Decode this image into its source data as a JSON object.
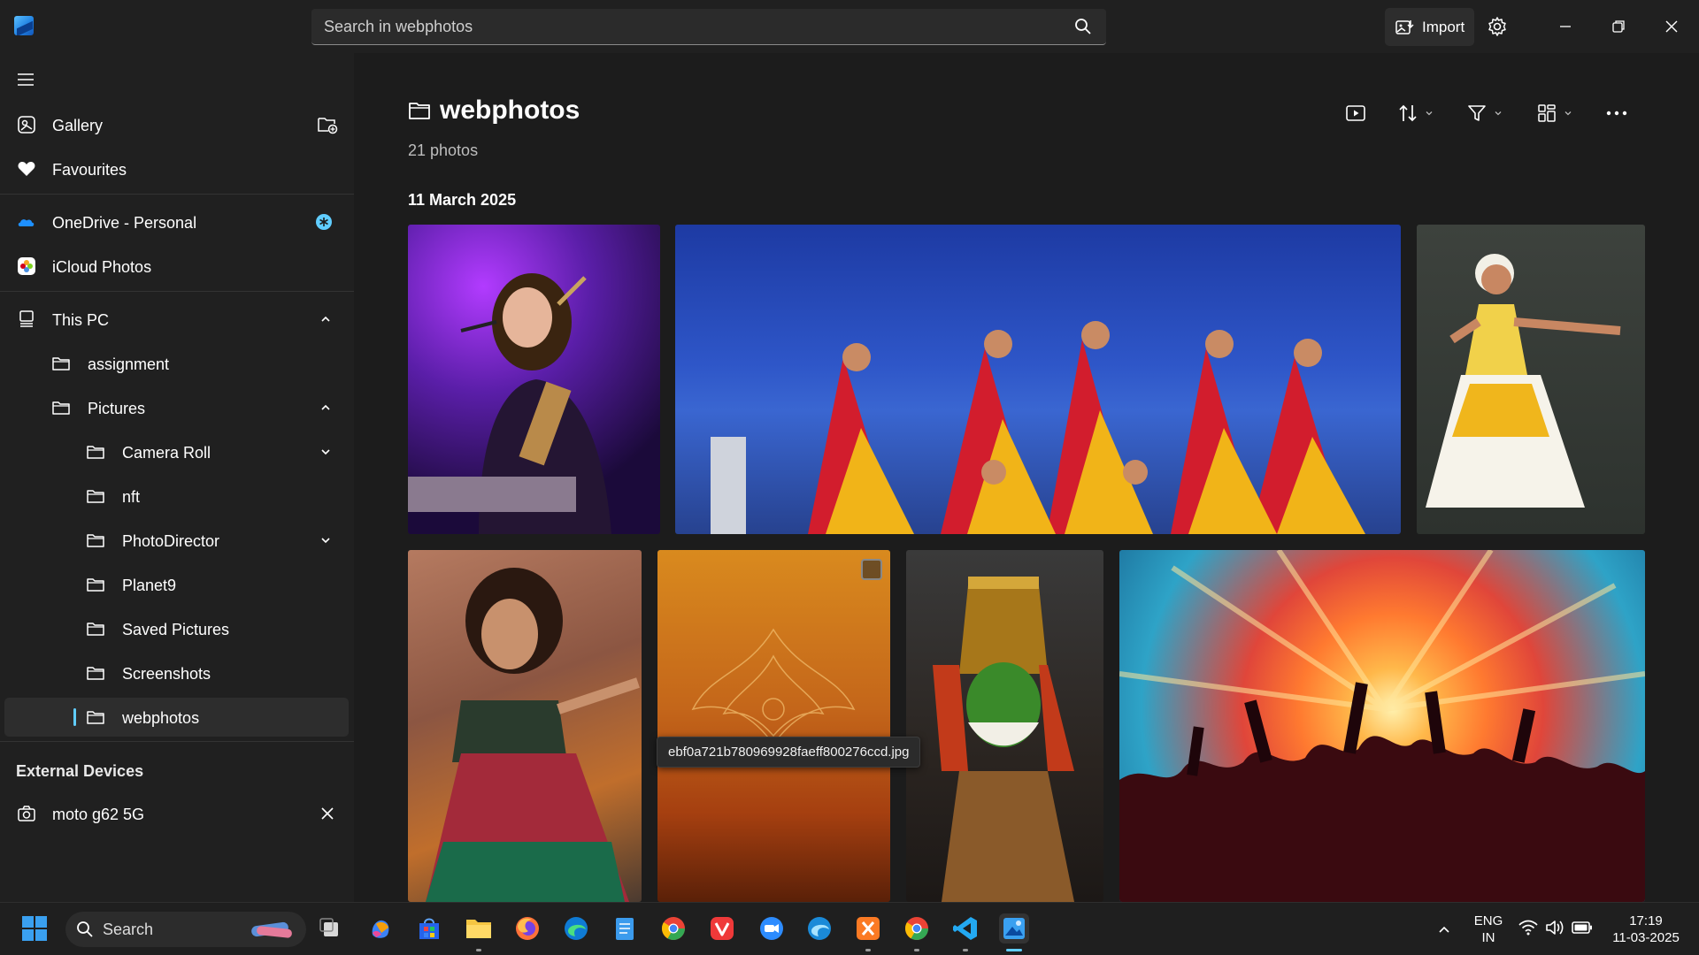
{
  "titlebar": {
    "search_placeholder": "Search in webphotos",
    "import_label": "Import"
  },
  "sidebar": {
    "gallery": "Gallery",
    "favourites": "Favourites",
    "onedrive": "OneDrive - Personal",
    "icloud": "iCloud Photos",
    "this_pc": "This PC",
    "folders": [
      "assignment",
      "Pictures",
      "Camera Roll",
      "nft",
      "PhotoDirector",
      "Planet9",
      "Saved Pictures",
      "Screenshots",
      "webphotos"
    ],
    "external_title": "External Devices",
    "device": "moto g62 5G"
  },
  "main": {
    "title": "webphotos",
    "count": "21 photos",
    "date_header": "11 March 2025",
    "tooltip": "ebf0a721b780969928faeff800276ccd.jpg"
  },
  "taskbar": {
    "search_label": "Search",
    "lang_top": "ENG",
    "lang_bottom": "IN",
    "time": "17:19",
    "date": "11-03-2025"
  },
  "colors": {
    "accent": "#60cdff",
    "onedrive_badge": "#60cdff",
    "background": "#1c1c1c",
    "sidebar": "#202020"
  }
}
